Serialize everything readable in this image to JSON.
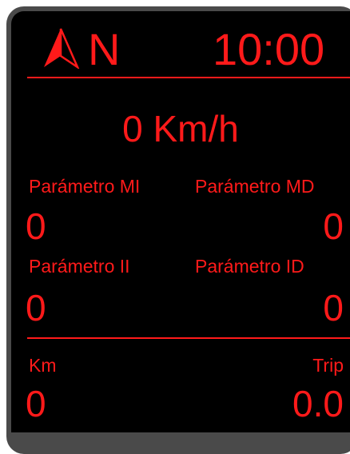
{
  "header": {
    "heading": "N",
    "time": "10:00",
    "compass_icon": "compass-arrow-icon"
  },
  "speed": {
    "value": "0 Km/h"
  },
  "parameters": {
    "mi": {
      "label": "Parámetro MI",
      "value": "0"
    },
    "md": {
      "label": "Parámetro MD",
      "value": "0"
    },
    "ii": {
      "label": "Parámetro II",
      "value": "0"
    },
    "id": {
      "label": "Parámetro ID",
      "value": "0"
    }
  },
  "odometer": {
    "km_label": "Km",
    "km_value": "0",
    "trip_label": "Trip",
    "trip_value": "0.0"
  },
  "colors": {
    "accent": "#ff1a1a",
    "background": "#000000",
    "bezel": "#4a4a4a"
  }
}
